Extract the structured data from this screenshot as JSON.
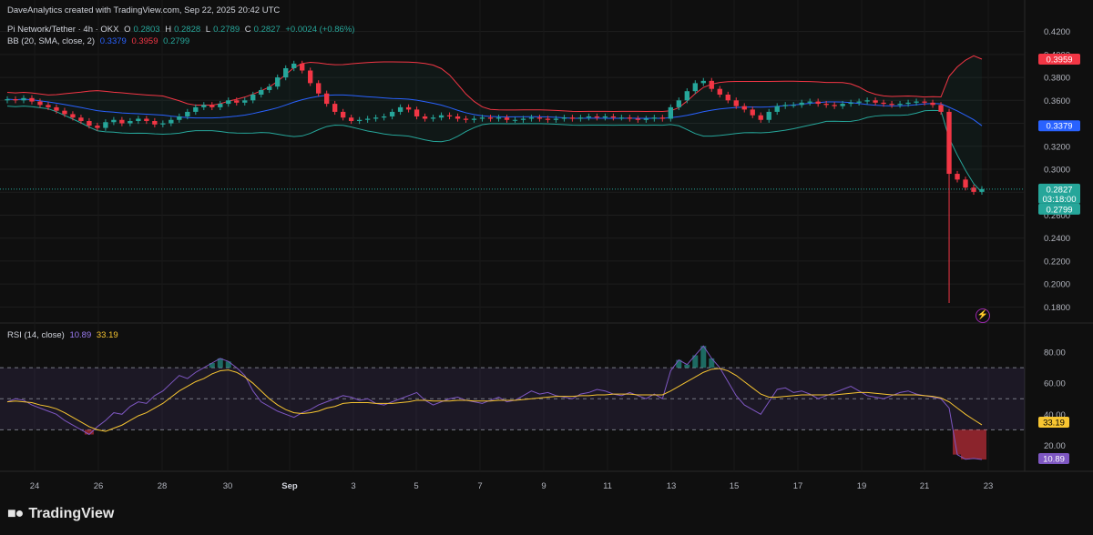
{
  "header": {
    "creator": "DaveAnalytics created with TradingView.com, Sep 22, 2025 20:42 UTC",
    "symbol": "Pi Network/Tether · 4h · OKX",
    "o_label": "O",
    "o": "0.2803",
    "h_label": "H",
    "h": "0.2828",
    "l_label": "L",
    "l": "0.2789",
    "c_label": "C",
    "c": "0.2827",
    "change": "+0.0024 (+0.86%)",
    "bb_label": "BB (20, SMA, close, 2)",
    "bb_basis": "0.3379",
    "bb_upper": "0.3959",
    "bb_lower": "0.2799",
    "rsi_label": "RSI (14, close)",
    "rsi_value": "10.89",
    "rsi_ma": "33.19"
  },
  "brand": {
    "name": "TradingView"
  },
  "colors": {
    "background": "#0f0f0f",
    "up": "#26a69a",
    "down": "#f23645",
    "bb_basis": "#2962ff",
    "bb_upper": "#f23645",
    "bb_lower": "#26a69a",
    "rsi": "#7e57c2",
    "rsi_ma": "#f7c531",
    "grid": "#1e1e1e"
  },
  "icons": {
    "alert": "lightning-icon",
    "logo": "tradingview-logo-icon"
  },
  "chart_data": [
    {
      "type": "candlestick",
      "title": "Pi Network/Tether · 4h · OKX",
      "ylim": [
        0.17,
        0.43
      ],
      "y_ticks": [
        "0.4200",
        "0.4000",
        "0.3800",
        "0.3600",
        "0.3400",
        "0.3200",
        "0.3000",
        "0.2800",
        "0.2600",
        "0.2400",
        "0.2200",
        "0.2000",
        "0.1800"
      ],
      "x_ticks": [
        "24",
        "26",
        "28",
        "30",
        "Sep",
        "3",
        "5",
        "7",
        "9",
        "11",
        "13",
        "15",
        "17",
        "19",
        "21",
        "23"
      ],
      "price_labels": [
        {
          "text": "0.3959",
          "value": 0.3959,
          "color": "#f23645"
        },
        {
          "text": "0.3379",
          "value": 0.3379,
          "color": "#2962ff"
        },
        {
          "text": "0.2827",
          "value": 0.2827,
          "color": "#26a69a",
          "sub": "03:18:00"
        },
        {
          "text": "0.2799",
          "value": 0.2799,
          "color": "#26a69a"
        }
      ],
      "last_price": 0.2827,
      "min_wick": 0.1835,
      "series_close": [
        0.361,
        0.36,
        0.362,
        0.359,
        0.356,
        0.354,
        0.351,
        0.348,
        0.345,
        0.342,
        0.338,
        0.336,
        0.341,
        0.343,
        0.34,
        0.342,
        0.344,
        0.342,
        0.339,
        0.34,
        0.343,
        0.346,
        0.35,
        0.354,
        0.356,
        0.354,
        0.357,
        0.36,
        0.358,
        0.36,
        0.365,
        0.369,
        0.372,
        0.38,
        0.388,
        0.392,
        0.386,
        0.375,
        0.366,
        0.357,
        0.35,
        0.345,
        0.342,
        0.343,
        0.344,
        0.345,
        0.346,
        0.35,
        0.354,
        0.352,
        0.346,
        0.344,
        0.345,
        0.347,
        0.346,
        0.344,
        0.343,
        0.344,
        0.345,
        0.344,
        0.345,
        0.343,
        0.343,
        0.344,
        0.345,
        0.344,
        0.343,
        0.344,
        0.345,
        0.344,
        0.345,
        0.346,
        0.345,
        0.346,
        0.345,
        0.345,
        0.344,
        0.343,
        0.344,
        0.345,
        0.344,
        0.354,
        0.36,
        0.368,
        0.375,
        0.377,
        0.37,
        0.365,
        0.36,
        0.355,
        0.352,
        0.347,
        0.343,
        0.35,
        0.355,
        0.356,
        0.356,
        0.358,
        0.359,
        0.357,
        0.356,
        0.355,
        0.357,
        0.358,
        0.359,
        0.36,
        0.358,
        0.357,
        0.356,
        0.357,
        0.358,
        0.359,
        0.358,
        0.356,
        0.35,
        0.296,
        0.291,
        0.284,
        0.2803,
        0.2827
      ]
    },
    {
      "type": "line",
      "title": "RSI (14, close)",
      "ylim": [
        5,
        90
      ],
      "y_ticks": [
        "80.00",
        "60.00",
        "40.00",
        "20.00"
      ],
      "bands": {
        "upper": 70,
        "middle": 50,
        "lower": 30
      },
      "value_labels": [
        {
          "text": "33.19",
          "value": 33.19,
          "color": "#f7c531",
          "text_color": "#000000"
        },
        {
          "text": "10.89",
          "value": 10.89,
          "color": "#7e57c2",
          "text_color": "#ffffff"
        }
      ],
      "rsi": [
        48,
        50,
        49,
        46,
        44,
        42,
        40,
        36,
        33,
        30,
        27,
        32,
        36,
        41,
        40,
        45,
        48,
        47,
        52,
        55,
        60,
        65,
        63,
        67,
        70,
        73,
        76,
        74,
        70,
        65,
        55,
        48,
        45,
        42,
        40,
        38,
        41,
        43,
        46,
        48,
        50,
        52,
        51,
        49,
        50,
        47,
        46,
        48,
        50,
        52,
        54,
        49,
        46,
        48,
        50,
        51,
        49,
        48,
        47,
        49,
        51,
        48,
        49,
        52,
        55,
        53,
        54,
        52,
        51,
        50,
        53,
        54,
        56,
        55,
        53,
        52,
        54,
        52,
        50,
        53,
        50,
        68,
        75,
        72,
        78,
        84,
        76,
        70,
        61,
        52,
        46,
        43,
        40,
        48,
        56,
        57,
        54,
        55,
        53,
        50,
        52,
        54,
        56,
        58,
        55,
        52,
        51,
        50,
        52,
        54,
        55,
        53,
        52,
        51,
        50,
        44,
        14,
        11,
        11.5,
        10.89
      ],
      "rsi_ma": [
        48,
        48.5,
        48,
        47.5,
        46,
        45,
        43.5,
        41,
        38,
        35,
        32,
        30,
        29,
        31,
        33,
        36,
        39,
        41,
        44,
        47,
        51,
        55,
        58,
        61,
        63,
        66,
        68,
        68.5,
        67,
        64,
        60,
        55,
        50,
        46,
        43,
        41,
        40.5,
        41,
        42,
        44,
        45,
        47,
        47.5,
        47.5,
        47.5,
        47,
        47,
        47,
        47.5,
        48,
        49,
        49,
        48.5,
        48.5,
        48.5,
        49,
        49,
        48.5,
        48.5,
        48.5,
        49,
        49,
        49,
        49.5,
        50,
        50.5,
        51,
        51.5,
        51.5,
        51.5,
        52,
        52,
        52.5,
        52.5,
        53,
        53,
        53,
        52.5,
        52.5,
        52.5,
        52.5,
        55,
        58,
        61,
        64,
        67,
        69,
        69.5,
        68,
        65,
        61,
        57,
        53,
        51,
        51,
        51.5,
        52,
        52.5,
        52.5,
        52.5,
        52.5,
        52.5,
        53,
        53.5,
        54,
        54,
        53.5,
        53,
        52.5,
        52.5,
        52.5,
        52.5,
        52,
        51.5,
        50.5,
        48,
        44,
        40,
        36.5,
        33.19
      ]
    }
  ]
}
